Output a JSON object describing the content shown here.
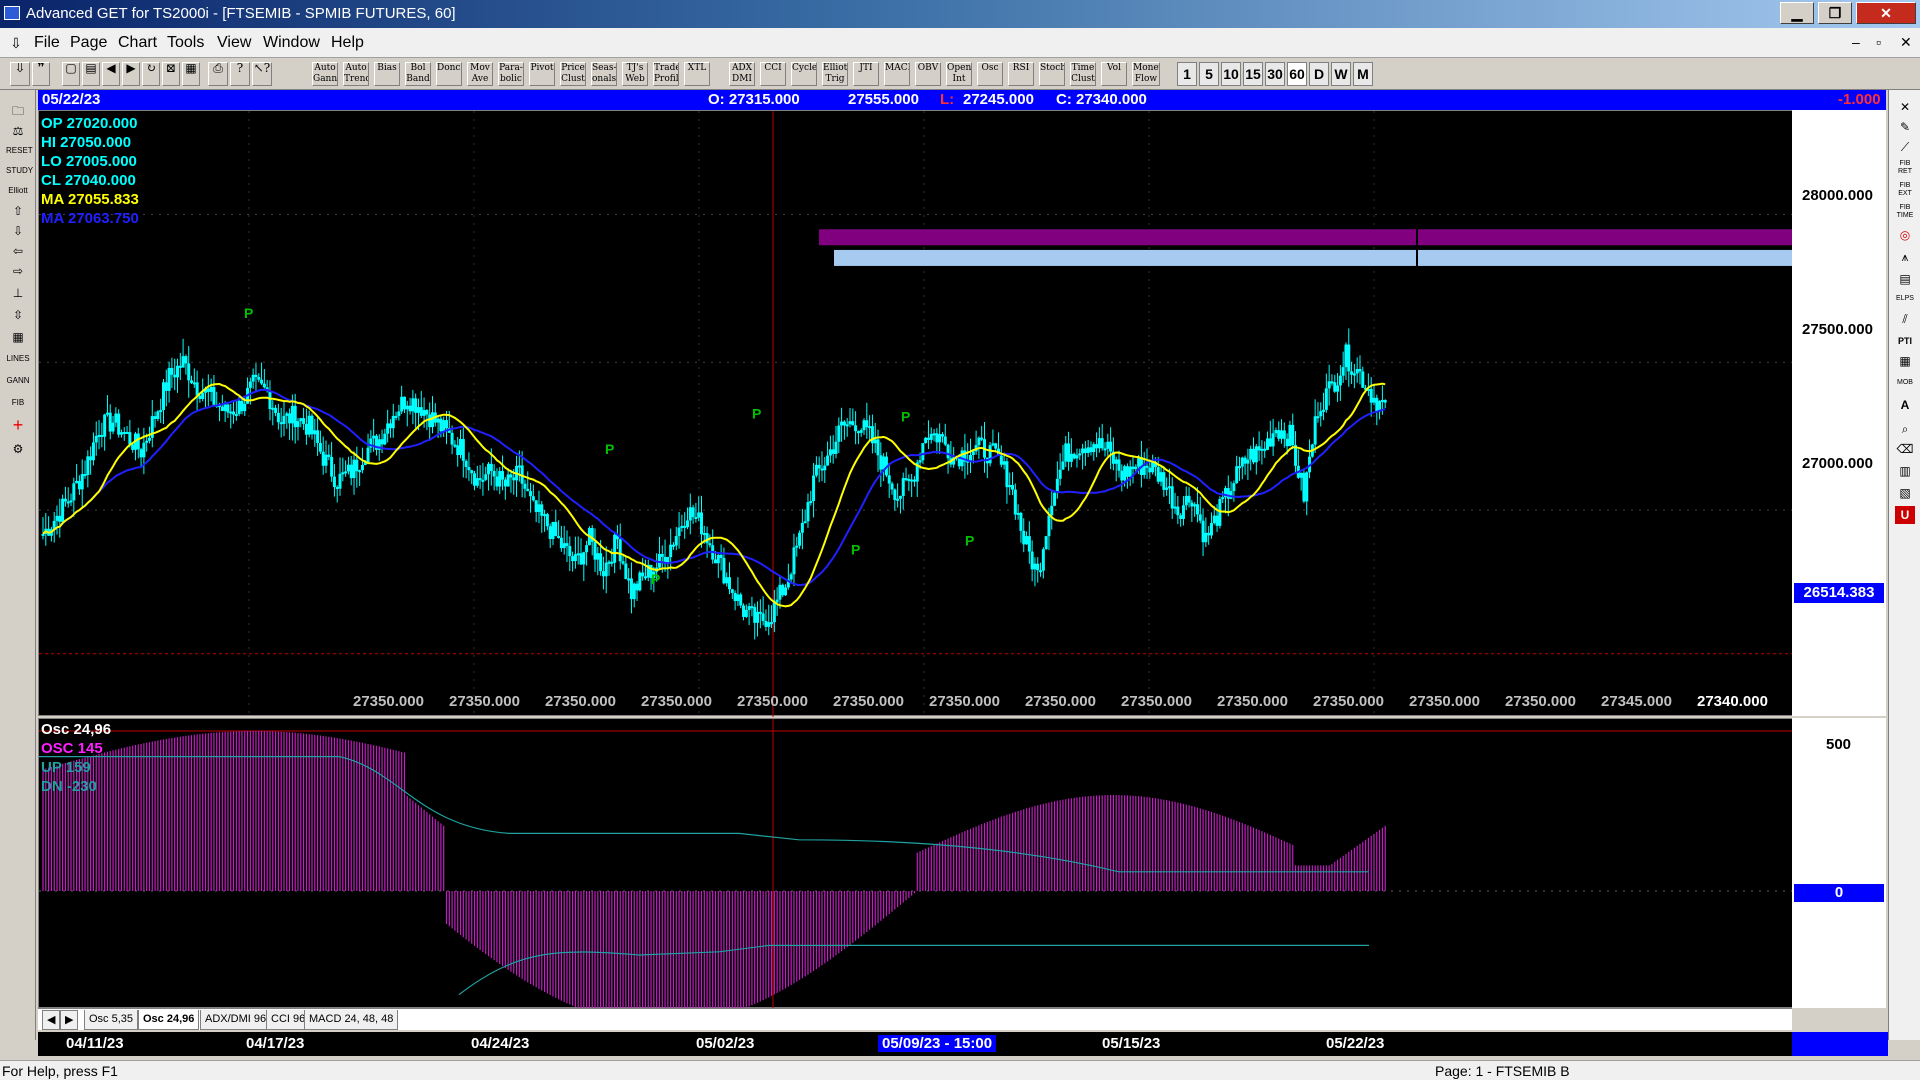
{
  "window": {
    "title": "Advanced GET for TS2000i - [FTSEMIB - SPMIB FUTURES, 60]",
    "minimize": "▁",
    "restore": "❐",
    "close": "✕",
    "mdi_min": "–",
    "mdi_restore": "▫",
    "mdi_close": "✕"
  },
  "menu": [
    "File",
    "Page",
    "Chart",
    "Tools",
    "View",
    "Window",
    "Help"
  ],
  "toolbar": {
    "tools": [
      "Auto Gann",
      "Auto Trend",
      "Bias",
      "Bol Band",
      "Donch",
      "Mov Ave",
      "Para-bolic",
      "Pivot",
      "Price Clust",
      "Seas-onals",
      "TJ's Web",
      "Trade Profile",
      "XTL",
      "ADX DMI",
      "CCI",
      "Cycles",
      "Elliott Trig",
      "JTI",
      "MACD",
      "OBV",
      "Open Int",
      "Osc",
      "RSI",
      "Stoch",
      "Time Clust",
      "Vol",
      "Money Flow"
    ],
    "intervals": [
      "1",
      "5",
      "10",
      "15",
      "30",
      "60",
      "D",
      "W",
      "M"
    ]
  },
  "infobar": {
    "date": "05/22/23",
    "open": "O: 27315.000",
    "high": "27555.000",
    "low_label": "L:",
    "low": "27245.000",
    "close": "C: 27340.000",
    "change": "-1.000"
  },
  "overlay": {
    "op": "OP  27020.000",
    "hi": "HI   27050.000",
    "lo": "LO  27005.000",
    "cl": "CL  27040.000",
    "ma1": "MA  27055.833",
    "ma2": "MA  27063.750"
  },
  "price_labels": [
    "28000.000",
    "27500.000",
    "27000.000"
  ],
  "last_price": "26514.383",
  "bottom_values": [
    "27350.000",
    "27350.000",
    "27350.000",
    "27350.000",
    "27350.000",
    "27350.000",
    "27350.000",
    "27350.000",
    "27350.000",
    "27350.000",
    "27350.000",
    "27350.000",
    "27350.000",
    "27345.000",
    "27340.000"
  ],
  "pivot_marker": "P",
  "osc": {
    "title": "Osc 24,96",
    "osc": "OSC 145",
    "up": "UP   159",
    "dn": "DN   -230",
    "scale_500": "500",
    "scale_0": "0"
  },
  "tabs": [
    "Osc 5,35",
    "Osc 24,96",
    "ADX/DMI 96",
    "CCI 96",
    "MACD 24, 48, 48"
  ],
  "tab_nav": {
    "prev": "◀",
    "next": "▶"
  },
  "dates": [
    "04/11/23",
    "04/17/23",
    "04/24/23",
    "05/02/23",
    "05/09/23 - 15:00",
    "05/15/23",
    "05/22/23"
  ],
  "status": {
    "help": "For Help, press F1",
    "page": "Page: 1 - FTSEMIB B"
  },
  "colors": {
    "bars": "#00ffff",
    "ma_fast": "#ffff00",
    "ma_slow": "#2020ff",
    "osc": "#c020c0",
    "cursor": "#c00000",
    "pivot": "#00c000",
    "zone_purple": "#800080",
    "zone_blue": "#a6caf0"
  },
  "chart_data": {
    "type": "candlestick",
    "symbol": "FTSEMIB",
    "interval": "60",
    "ylim": [
      26300,
      28350
    ],
    "x_dates": [
      "04/11/23",
      "04/17/23",
      "04/24/23",
      "05/02/23",
      "05/09/23 - 15:00",
      "05/15/23",
      "05/22/23"
    ],
    "close_path": [
      26920,
      26980,
      27050,
      27140,
      27280,
      27300,
      27250,
      27200,
      27320,
      27450,
      27500,
      27420,
      27380,
      27330,
      27350,
      27420,
      27400,
      27300,
      27320,
      27280,
      27180,
      27100,
      27130,
      27200,
      27240,
      27330,
      27380,
      27350,
      27300,
      27250,
      27200,
      27100,
      27130,
      27080,
      27120,
      27000,
      26950,
      26880,
      26820,
      26900,
      26800,
      26900,
      26720,
      26780,
      26820,
      26900,
      27000,
      26950,
      26850,
      26750,
      26660,
      26620,
      26650,
      26750,
      26900,
      27100,
      27180,
      27280,
      27300,
      27250,
      27150,
      27050,
      27100,
      27260,
      27250,
      27180,
      27200,
      27210,
      27180,
      27100,
      26900,
      26780,
      27050,
      27190,
      27220,
      27230,
      27200,
      27120,
      27150,
      27150,
      27100,
      27000,
      27050,
      26900,
      27000,
      27100,
      27180,
      27200,
      27280,
      27250,
      27050,
      27350,
      27420,
      27520,
      27460,
      27380,
      27340
    ],
    "pivots": [
      {
        "label": "P",
        "date_index": 1,
        "value": 27650
      },
      {
        "label": "P",
        "date_index": 3,
        "value": 26750
      },
      {
        "label": "P",
        "date_index": 3,
        "value": 27190
      },
      {
        "label": "P",
        "date_index": 4,
        "value": 27310
      },
      {
        "label": "P",
        "date_index": 5,
        "value": 26850
      },
      {
        "label": "P",
        "date_index": 5,
        "value": 27300
      },
      {
        "label": "P",
        "date_index": 5,
        "value": 26880
      }
    ],
    "osc_series": {
      "osc": 145,
      "up": 159,
      "dn": -230
    }
  }
}
